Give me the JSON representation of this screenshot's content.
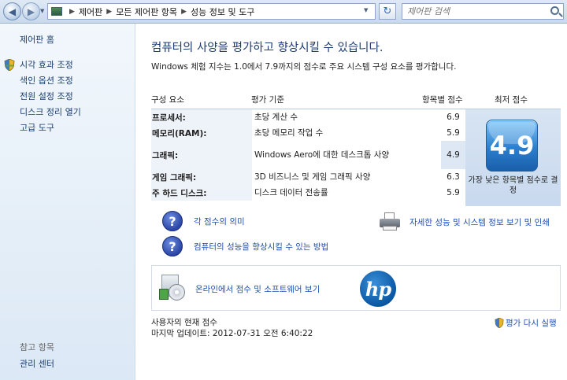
{
  "address_bar": {
    "breadcrumbs": [
      "제어판",
      "모든 제어판 항목",
      "성능 정보 및 도구"
    ],
    "search_placeholder": "제어판 검색"
  },
  "sidebar": {
    "home": "제어판 홈",
    "items": [
      {
        "label": "시각 효과 조정",
        "icon": "shield-icon"
      },
      {
        "label": "색인 옵션 조정"
      },
      {
        "label": "전원 설정 조정"
      },
      {
        "label": "디스크 정리 열기"
      },
      {
        "label": "고급 도구"
      }
    ],
    "see_also": "참고 항목",
    "admin_center": "관리 센터"
  },
  "main": {
    "title": "컴퓨터의 사양을 평가하고 향상시킬 수 있습니다.",
    "description": "Windows 체험 지수는 1.0에서 7.9까지의 점수로 주요 시스템 구성 요소를 평가합니다.",
    "table": {
      "headers": {
        "component": "구성 요소",
        "criteria": "평가 기준",
        "subscore": "항목별 점수",
        "basescore": "최저 점수"
      },
      "rows": [
        {
          "component": "프로세서:",
          "criteria": "초당 계산 수",
          "subscore": "6.9"
        },
        {
          "component": "메모리(RAM):",
          "criteria": "초당 메모리 작업 수",
          "subscore": "5.9"
        },
        {
          "component": "그래픽:",
          "criteria": "Windows Aero에 대한 데스크톱 사양",
          "subscore": "4.9"
        },
        {
          "component": "게임 그래픽:",
          "criteria": "3D 비즈니스 및 게임 그래픽 사양",
          "subscore": "6.3"
        },
        {
          "component": "주 하드 디스크:",
          "criteria": "디스크 데이터 전송률",
          "subscore": "5.9"
        }
      ],
      "base_score": "4.9",
      "base_score_note": "가장 낮은 항목별 점수로 결정"
    },
    "links": {
      "score_meaning": "각 점수의 의미",
      "improve_tips": "컴퓨터의 성능을 향상시킬 수 있는 방법",
      "print_details": "자세한 성능 및 시스템 정보 보기 및 인쇄",
      "online": "온라인에서 점수 및 소프트웨어 보기",
      "rerate": "평가 다시 실행"
    },
    "current_score_label": "사용자의 현재 점수",
    "last_update": "마지막 업데이트: 2012-07-31 오전 6:40:22",
    "oem_logo": "hp"
  },
  "colors": {
    "link": "#1e4fb0",
    "title": "#1e3b73",
    "badge": "#2b7fcf"
  }
}
